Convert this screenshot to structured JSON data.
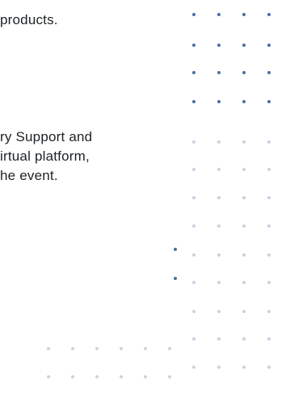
{
  "content": {
    "line_1": "products.",
    "line_2": "ry Support and",
    "line_3": "irtual  platform,",
    "line_4": "he event."
  },
  "colors": {
    "text": "#1d2125",
    "dot_strong": "#4a6fa5",
    "dot_faint": "#c9d3e3",
    "background": "#ffffff"
  }
}
